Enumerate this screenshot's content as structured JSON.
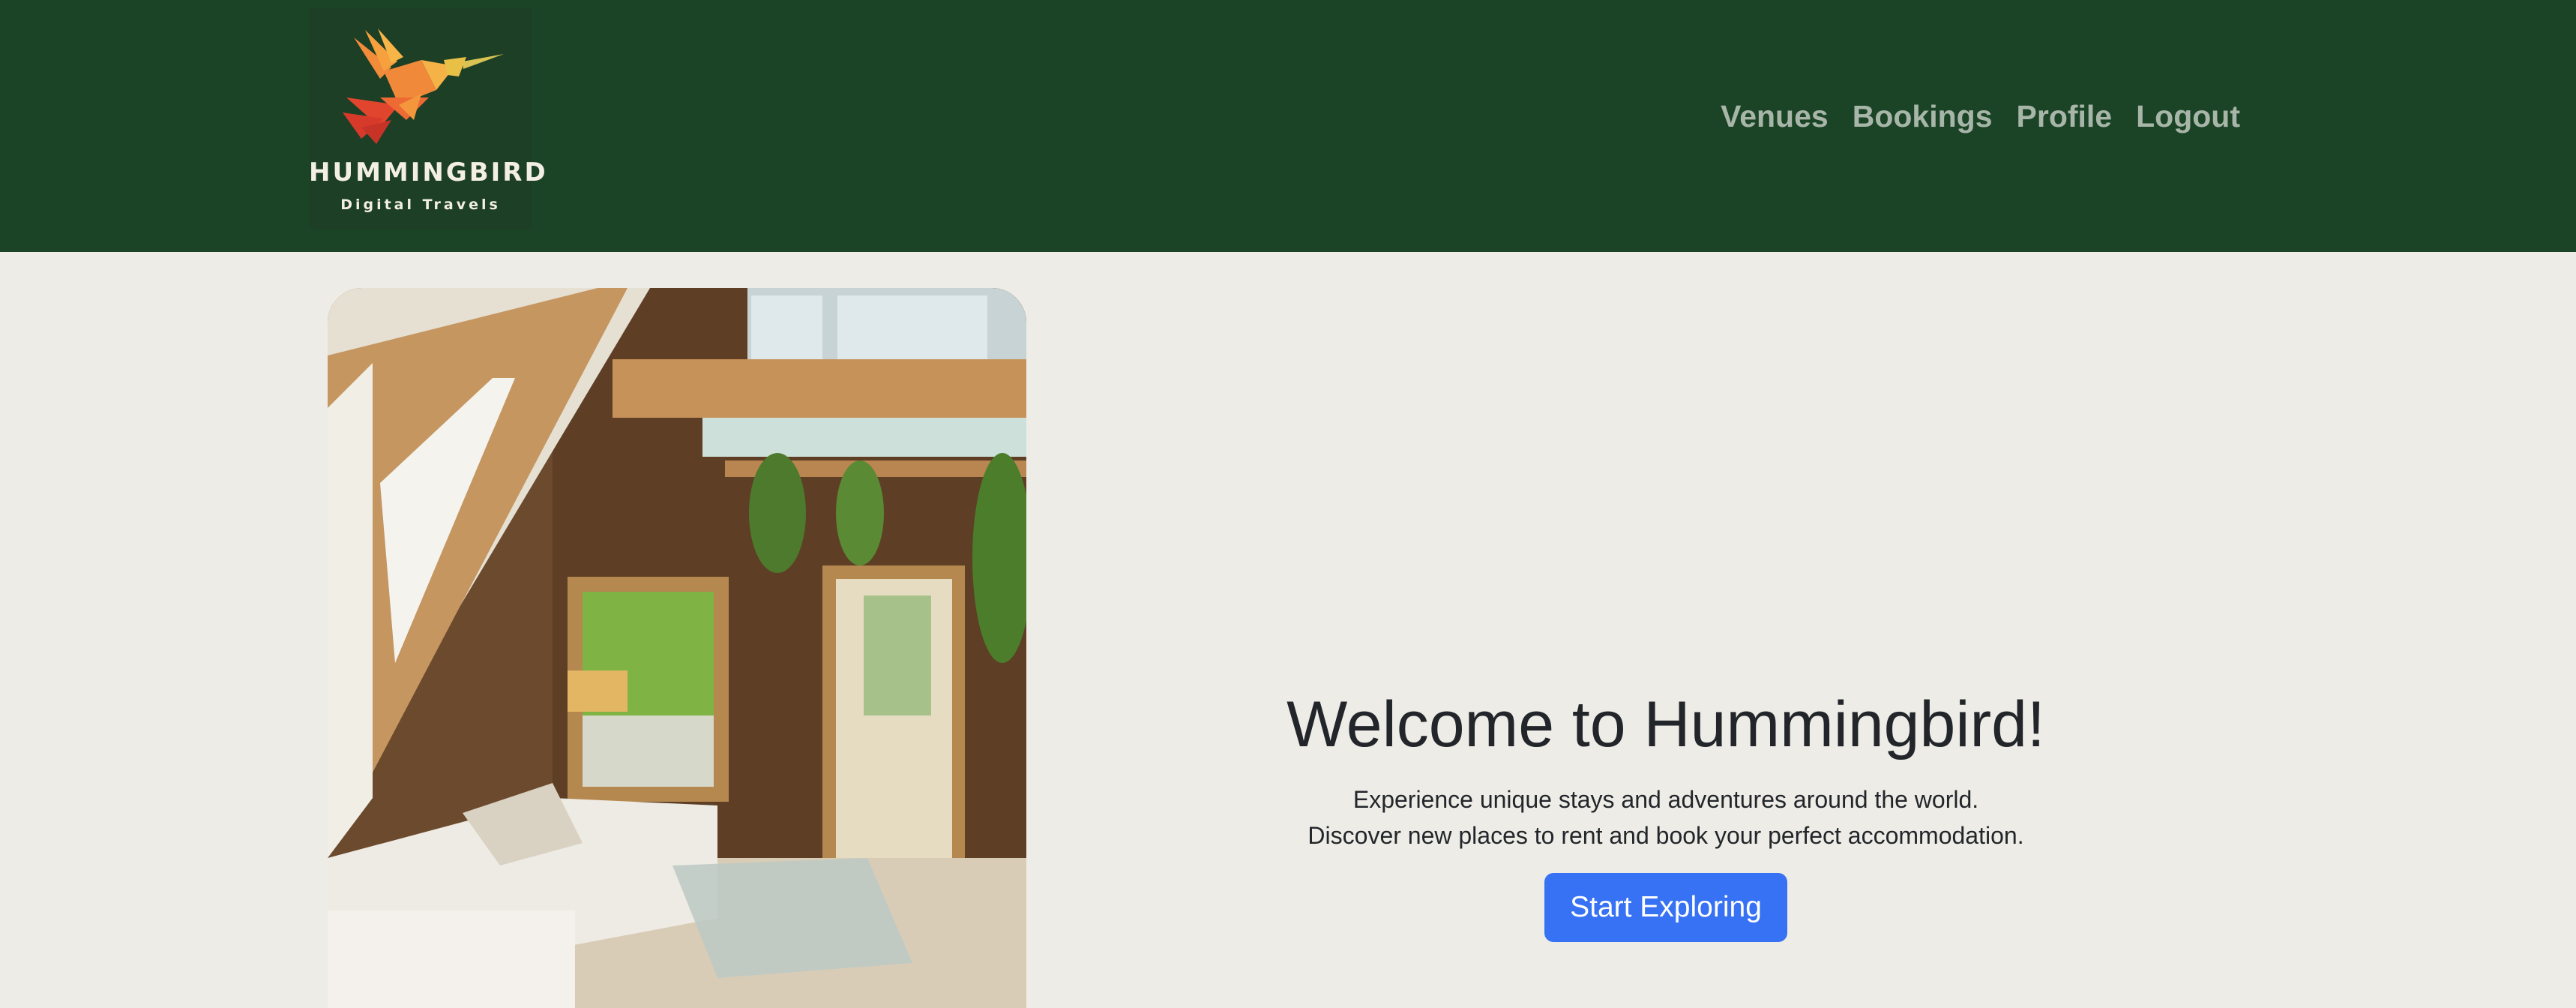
{
  "brand": {
    "name": "HUMMINGBIRD",
    "tagline": "Digital Travels"
  },
  "nav": {
    "items": [
      {
        "label": "Venues"
      },
      {
        "label": "Bookings"
      },
      {
        "label": "Profile"
      },
      {
        "label": "Logout"
      }
    ]
  },
  "hero": {
    "title": "Welcome to Hummingbird!",
    "subtitle_line1": "Experience unique stays and adventures around the world.",
    "subtitle_line2": "Discover new places to rent and book your perfect accommodation.",
    "cta_label": "Start Exploring"
  },
  "colors": {
    "navbar": "#1b4426",
    "background": "#eeece6",
    "nav_link": "#a7b6a9",
    "cta": "#3672f3"
  }
}
